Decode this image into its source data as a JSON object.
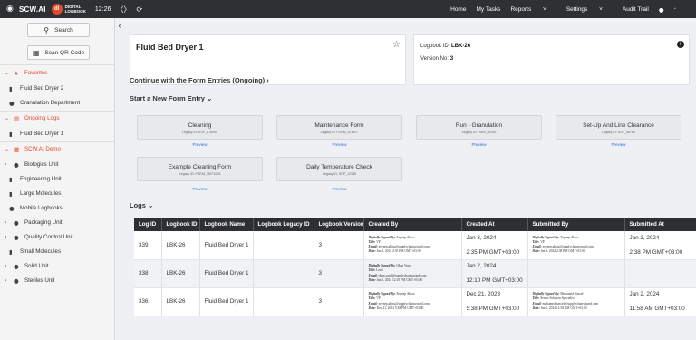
{
  "topbar": {
    "brand": "SCW.AI",
    "dl_badge": "dl",
    "dl_text_1": "DIGITAL",
    "dl_text_2": "LOGBOOK",
    "clock": "12:26",
    "nav": [
      "Home",
      "My Tasks",
      "Reports",
      "Settings",
      "Audit Trail"
    ]
  },
  "sidebar": {
    "search_label": "Search",
    "scan_label": "Scan QR Code",
    "favorites": "Favorites",
    "fav_items": [
      "Fluid Bed Dryer 2",
      "Granulation Department"
    ],
    "ongoing": "Ongoing Logs",
    "ongoing_items": [
      "Fluid Bed Dryer 1"
    ],
    "demo": "SCW.AI Demo",
    "demo_items": [
      "Biologics Unit",
      "Engineering Unit",
      "Large Molecules",
      "Mobile Logbooks",
      "Packaging Unit",
      "Quality Control Unit",
      "Small Molecules",
      "Solid Unit",
      "Steriles Unit"
    ]
  },
  "header": {
    "title": "Fluid Bed Dryer 1",
    "logbook_id_label": "Logbook ID:",
    "logbook_id": "LBK-26",
    "version_label": "Version No:",
    "version": "3"
  },
  "sections": {
    "continue": "Continue with the Form Entries (Ongoing)",
    "start": "Start a New Form Entry",
    "logs": "Logs"
  },
  "forms": [
    {
      "name": "Cleaning",
      "legacy": "Legacy ID: SOP_678090",
      "preview": "Preview"
    },
    {
      "name": "Maintenance Form",
      "legacy": "Legacy ID: FORM_674107",
      "preview": "Preview"
    },
    {
      "name": "Run - Granulation",
      "legacy": "Legacy ID: Form_56789",
      "preview": "Preview"
    },
    {
      "name": "Set-Up And Line Clearance",
      "legacy": "Legacy ID: SOP_98785",
      "preview": "Preview"
    },
    {
      "name": "Example Cleaning Form",
      "legacy": "Legacy ID: FORM_78071078",
      "preview": "Preview"
    },
    {
      "name": "Daily Temperature Check",
      "legacy": "Legacy ID: SOP_12345",
      "preview": "Preview"
    }
  ],
  "table": {
    "columns": [
      "Log ID",
      "Logbook ID",
      "Logbook Name",
      "Logbook Legacy ID",
      "Logbook Version",
      "Created By",
      "Created At",
      "Submitted By",
      "Submitted At"
    ],
    "rows": [
      {
        "log_id": "339",
        "logbook_id": "LBK-26",
        "name": "Fluid Bed Dryer 1",
        "legacy": "",
        "version": "3",
        "created_by": {
          "signed": "Zeynep Akısu",
          "title": "VP",
          "email": "zeynep.akisu@supplychainwizard.com",
          "date": "Jan 3, 2024 2:35 PM GMT+03:00"
        },
        "created_date": "Jan 3, 2024",
        "created_time": "2:35 PM GMT+03:00",
        "submitted_by": {
          "signed": "Zeynep Akısu",
          "title": "VP",
          "email": "zeynep.akisu@supplychainwizard.com",
          "date": "Jan 3, 2024 2:38 PM GMT+03:00"
        },
        "submitted_date": "Jan 3, 2024",
        "submitted_time": "2:38 PM GMT+03:00"
      },
      {
        "log_id": "338",
        "logbook_id": "LBK-26",
        "name": "Fluid Bed Dryer 1",
        "legacy": "",
        "version": "3",
        "created_by": {
          "signed": "Okan Varol",
          "title": "Lead",
          "email": "okan.varol@supplychainwizard.com",
          "date": "Jan 2, 2024 12:10 PM GMT+03:00"
        },
        "created_date": "Jan 2, 2024",
        "created_time": "12:10 PM GMT+03:00",
        "submitted_by": null,
        "submitted_date": "",
        "submitted_time": ""
      },
      {
        "log_id": "336",
        "logbook_id": "LBK-26",
        "name": "Fluid Bed Dryer 1",
        "legacy": "",
        "version": "3",
        "created_by": {
          "signed": "Zeynep Akısu",
          "title": "VP",
          "email": "zeynep.akisu@supplychainwizard.com",
          "date": "Dec 21, 2023 5:38 PM GMT+03:00"
        },
        "created_date": "Dec 21, 2023",
        "created_time": "5:38 PM GMT+03:00",
        "submitted_by": {
          "signed": "Mohamed Nassef",
          "title": "Senior Solution Specialist",
          "email": "mohamed.nassef@supplychainwizard.com",
          "date": "Jan 2, 2024 11:58 AM GMT+03:00"
        },
        "submitted_date": "Jan 2, 2024",
        "submitted_time": "11:58 AM GMT+03:00"
      }
    ]
  },
  "sig_labels": {
    "signed": "Digitally Signed By:",
    "title": "Title:",
    "email": "Email:",
    "date": "Date:"
  },
  "colors": {
    "accent": "#e24a2b",
    "topbar": "#2f3033",
    "link": "#2a6fd6"
  },
  "icons": {
    "logo": "scw-logo-icon",
    "refresh": "refresh-icon",
    "user": "user-icon",
    "star": "star-outline-icon",
    "info": "info-icon"
  }
}
